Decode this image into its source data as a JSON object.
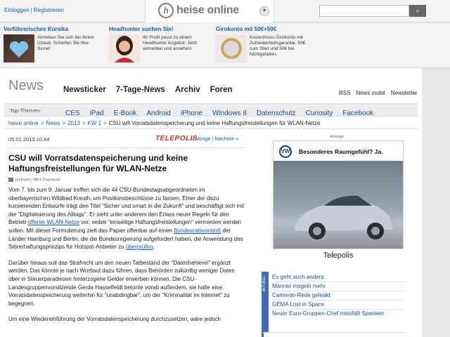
{
  "topbar": {
    "login": "Einloggen",
    "register": "Registrieren",
    "sep": "|",
    "logo_mark": "h",
    "logo_text": "heise online",
    "search_button": "⌕"
  },
  "teasers": [
    {
      "title": "Verführerisches Korsika",
      "text": "Verlieben Sie sich bei Ihrem Urlaub. Schärfen Sie Ihre Sinne!"
    },
    {
      "title": "Headhunter suchen Sie!",
      "text": "Ihr Profil passt zu einem Headhunter Angebot. Jetzt anmelden und ansehen!"
    },
    {
      "title": "Girokonto mit 50€+50€",
      "text": "Kostenloses Girokonto mit Zufriedenheitsgarantie. 50€ zum Start und 50€ bei Nichtgefallen."
    }
  ],
  "header": {
    "news": "News",
    "nav": [
      "Newsticker",
      "7-Tage-News",
      "Archiv",
      "Foren"
    ],
    "subnav": [
      "RSS",
      "News mobil",
      "Newsletter"
    ]
  },
  "topics": {
    "label": "Top-Themen:",
    "items": [
      "CES",
      "iPad",
      "E-Book",
      "Android",
      "iPhone",
      "Windows 8",
      "Datenschutz",
      "Curiosity",
      "Facebook"
    ]
  },
  "breadcrumb": {
    "items": [
      "heise online",
      "News",
      "2013",
      "KW 1"
    ],
    "current": "CSU will Vorratsdatenspeicherung und keine Haftungsfreistellungen für WLAN-Netze",
    "sep": ">"
  },
  "article": {
    "date": "05.01.2013 10:44",
    "source": "TELEPOLIS",
    "prev": "« Vorige",
    "next": "Nächste »",
    "sep": "|",
    "title": "CSU will Vorratsdatenspeicherung und keine Haftungsfreistellungen für WLAN-Netze",
    "audio": "vorlesen / MP3-Download",
    "p1a": "Vom 7. bis zum 9. Januar treffen sich die 44 CSU-Bundestagsabgeordneten im oberbayerischen Wildbad Kreuth, um Positionsbeschlüsse zu fassen. Einer der dazu kursierenden Entwürfe trägt den Titel \"Sicher und smart in die Zukunft\" und beschäftigt sich mit der \"Digitalisierung des Alltags\". Er sieht unter anderem den Erlass neuer Regeln für den Betrieb ",
    "p1link1": "offener WLAN-Netze",
    "p1b": " vor, wobei \"einseitige Haftungsfreistellungen\" vermieden werden sollen. Mit dieser Formulierung zielt das Papier offenbar auf einen ",
    "p1link2": "Bundesratsvorstoß",
    "p1c": " der Länder Hamburg und Berlin, die die Bundesregierung aufgefordert haben, die Anwendung des Störerhaftungsprinzips für Hotspot-Anbieter zu ",
    "p1link3": "überprüfen",
    "p1d": ".",
    "p2": "Darüber hinaus soll das Strafrecht um den neuen Tatbestand der \"Datenhehlerei\" ergänzt werden. Das könnte je nach Wortlaut dazu führen, dass Behörden zukünftig weniger Daten über in Steuerparadiesen hinterzogene Gelder erwerben können. Die CSU-Landesgruppenvorsitzende Gerda Hasselfeldt betonte vorab außerdem, sie halte eine Vorratsdatenspeicherung weiterhin für \"unabdingbar\", um der \"Kriminalität im Internet\" zu begegnen.",
    "p3": "Um eine Wiedereinführung der Vorratsdatenspeicherung durchzusetzen, wäre jedoch"
  },
  "sidebar": {
    "ad_label": "Anzeige",
    "ad_logo": "VW",
    "ad_slogan": "Besonderes Raumgefühl? Ja.",
    "caption": "Telepolis",
    "list_tag": "AKTUELL",
    "list": [
      "Es geht auch anders",
      "Männer mogeln mehr",
      "Cameron-Rede geleakt",
      "GEMA Lost in Space",
      "Neuer Euro-Gruppen-Chef missfällt Spaniern"
    ]
  }
}
